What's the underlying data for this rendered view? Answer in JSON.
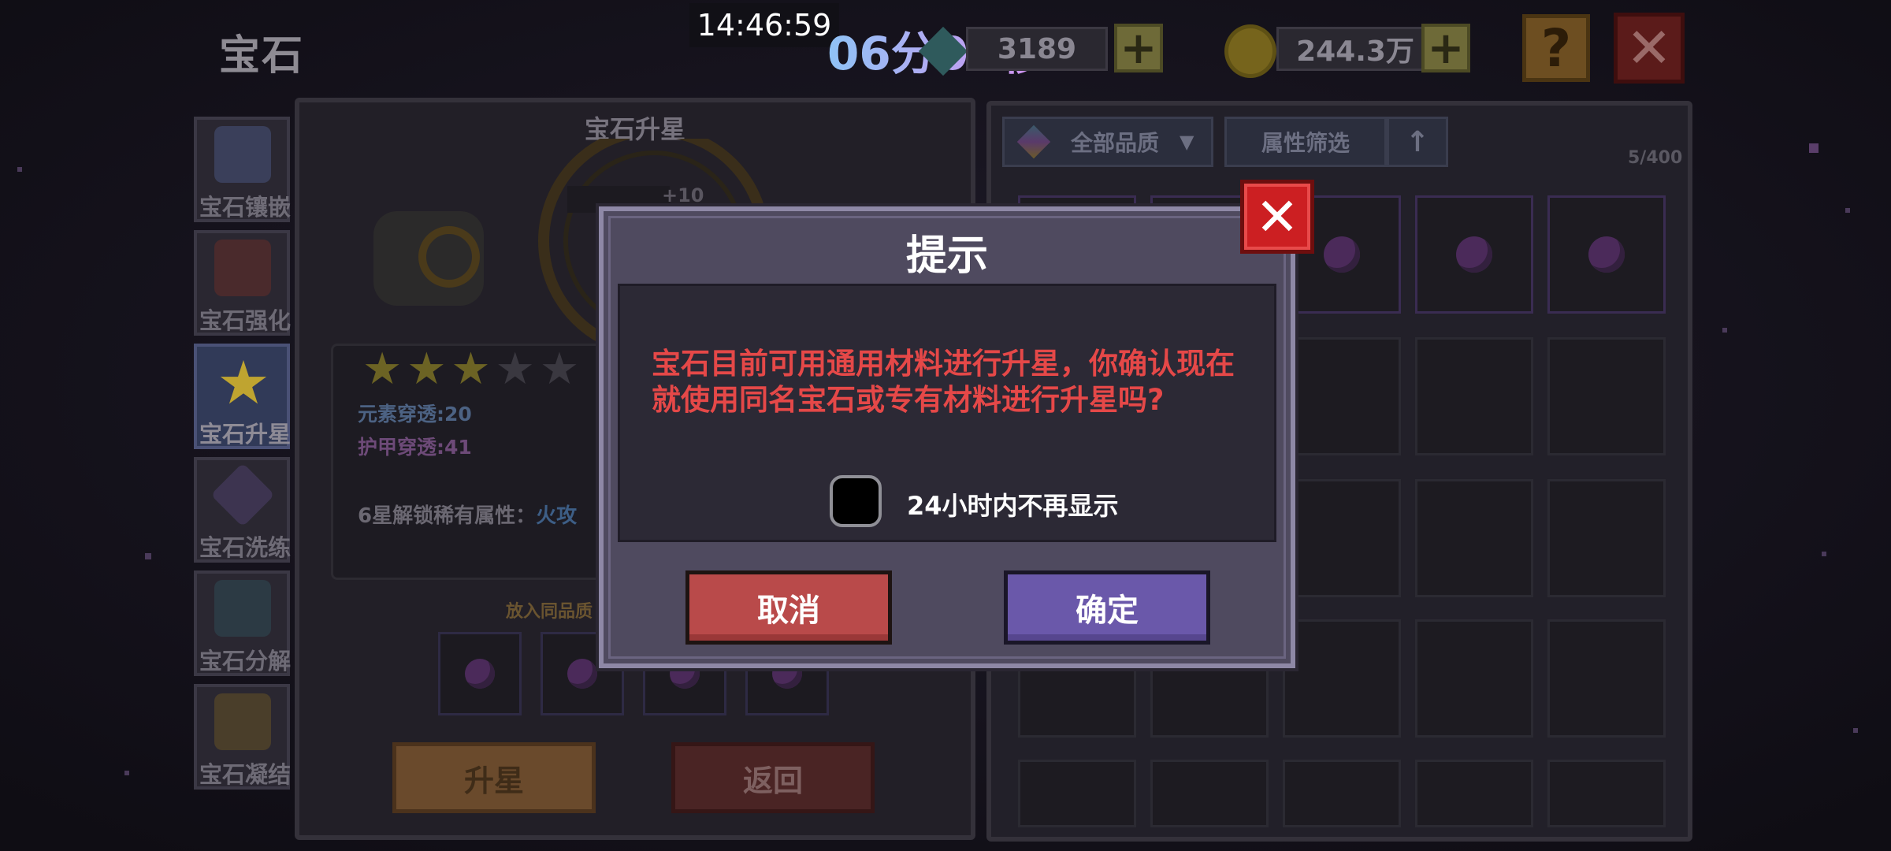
{
  "top_bar": {
    "page_title": "宝石",
    "clock": "14:46:59",
    "timer": "06分00秒",
    "gem_currency": {
      "value": "3189",
      "icon": "gem-icon",
      "add_icon": "plus-icon"
    },
    "gold_currency": {
      "value": "244.3万",
      "icon": "coin-icon",
      "add_icon": "plus-icon"
    },
    "help_label": "?",
    "close_label": "✕"
  },
  "left_menu": {
    "items": [
      {
        "label": "宝石镶嵌",
        "icon": "gem-inlay-icon",
        "active": false
      },
      {
        "label": "宝石强化",
        "icon": "gem-enhance-icon",
        "active": false
      },
      {
        "label": "宝石升星",
        "icon": "star-up-icon",
        "active": true
      },
      {
        "label": "宝石洗练",
        "icon": "gem-refine-icon",
        "active": false
      },
      {
        "label": "宝石分解",
        "icon": "gem-decompose-icon",
        "active": false
      },
      {
        "label": "宝石凝结",
        "icon": "gem-condense-icon",
        "active": false
      }
    ]
  },
  "upgrade_panel": {
    "header": "宝石升星",
    "level_badge": "+10",
    "stars_filled": 3,
    "stars_total": 5,
    "stats": {
      "element_pen": "元素穿透:20",
      "armor_pen": "护甲穿透:41",
      "unlock_prefix": "6星解锁稀有属性：",
      "unlock_value": "火攻"
    },
    "put_hint": "放入同品质",
    "buttons": {
      "upgrade": "升星",
      "back": "返回"
    }
  },
  "inventory": {
    "quality_filter": "全部品质",
    "attribute_filter": "属性筛选",
    "sort_icon": "arrow-up-icon",
    "capacity": "5/400"
  },
  "dialog": {
    "title": "提示",
    "message": "宝石目前可用通用材料进行升星，你确认现在就使用同名宝石或专有材料进行升星吗?",
    "checkbox_label": "24小时内不再显示",
    "checkbox_checked": false,
    "cancel": "取消",
    "confirm": "确定",
    "close_label": "✕"
  },
  "colors": {
    "timer_start": "#8fc3f5",
    "timer_end": "#d58ff0",
    "message_red": "#e54848",
    "cancel_red": "#b94a4a",
    "confirm_purple": "#6a58aa",
    "close_red": "#cc1f22"
  }
}
